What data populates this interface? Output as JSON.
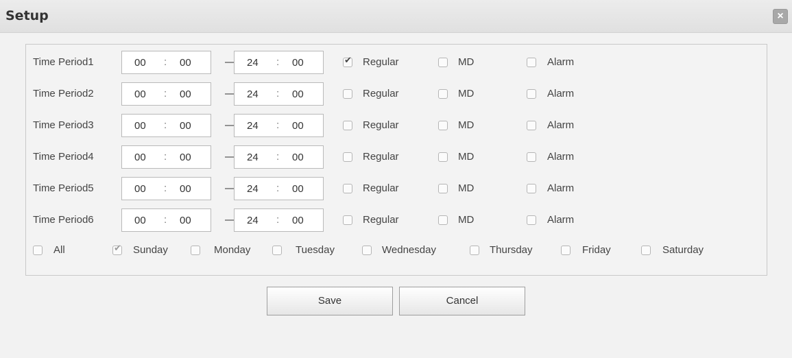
{
  "window": {
    "title": "Setup",
    "close_glyph": "×"
  },
  "time_periods": [
    {
      "label": "Time Period1",
      "start_h": "00",
      "start_m": "00",
      "end_h": "24",
      "end_m": "00",
      "regular": true,
      "md": false,
      "alarm": false
    },
    {
      "label": "Time Period2",
      "start_h": "00",
      "start_m": "00",
      "end_h": "24",
      "end_m": "00",
      "regular": false,
      "md": false,
      "alarm": false
    },
    {
      "label": "Time Period3",
      "start_h": "00",
      "start_m": "00",
      "end_h": "24",
      "end_m": "00",
      "regular": false,
      "md": false,
      "alarm": false
    },
    {
      "label": "Time Period4",
      "start_h": "00",
      "start_m": "00",
      "end_h": "24",
      "end_m": "00",
      "regular": false,
      "md": false,
      "alarm": false
    },
    {
      "label": "Time Period5",
      "start_h": "00",
      "start_m": "00",
      "end_h": "24",
      "end_m": "00",
      "regular": false,
      "md": false,
      "alarm": false
    },
    {
      "label": "Time Period6",
      "start_h": "00",
      "start_m": "00",
      "end_h": "24",
      "end_m": "00",
      "regular": false,
      "md": false,
      "alarm": false
    }
  ],
  "labels": {
    "time_sep": ":",
    "range_dash": "—",
    "regular": "Regular",
    "md": "MD",
    "alarm": "Alarm"
  },
  "days": [
    {
      "label": "All",
      "checked": false
    },
    {
      "label": "Sunday",
      "checked": true
    },
    {
      "label": "Monday",
      "checked": false
    },
    {
      "label": "Tuesday",
      "checked": false
    },
    {
      "label": "Wednesday",
      "checked": false
    },
    {
      "label": "Thursday",
      "checked": false
    },
    {
      "label": "Friday",
      "checked": false
    },
    {
      "label": "Saturday",
      "checked": false
    }
  ],
  "buttons": {
    "save": "Save",
    "cancel": "Cancel"
  }
}
